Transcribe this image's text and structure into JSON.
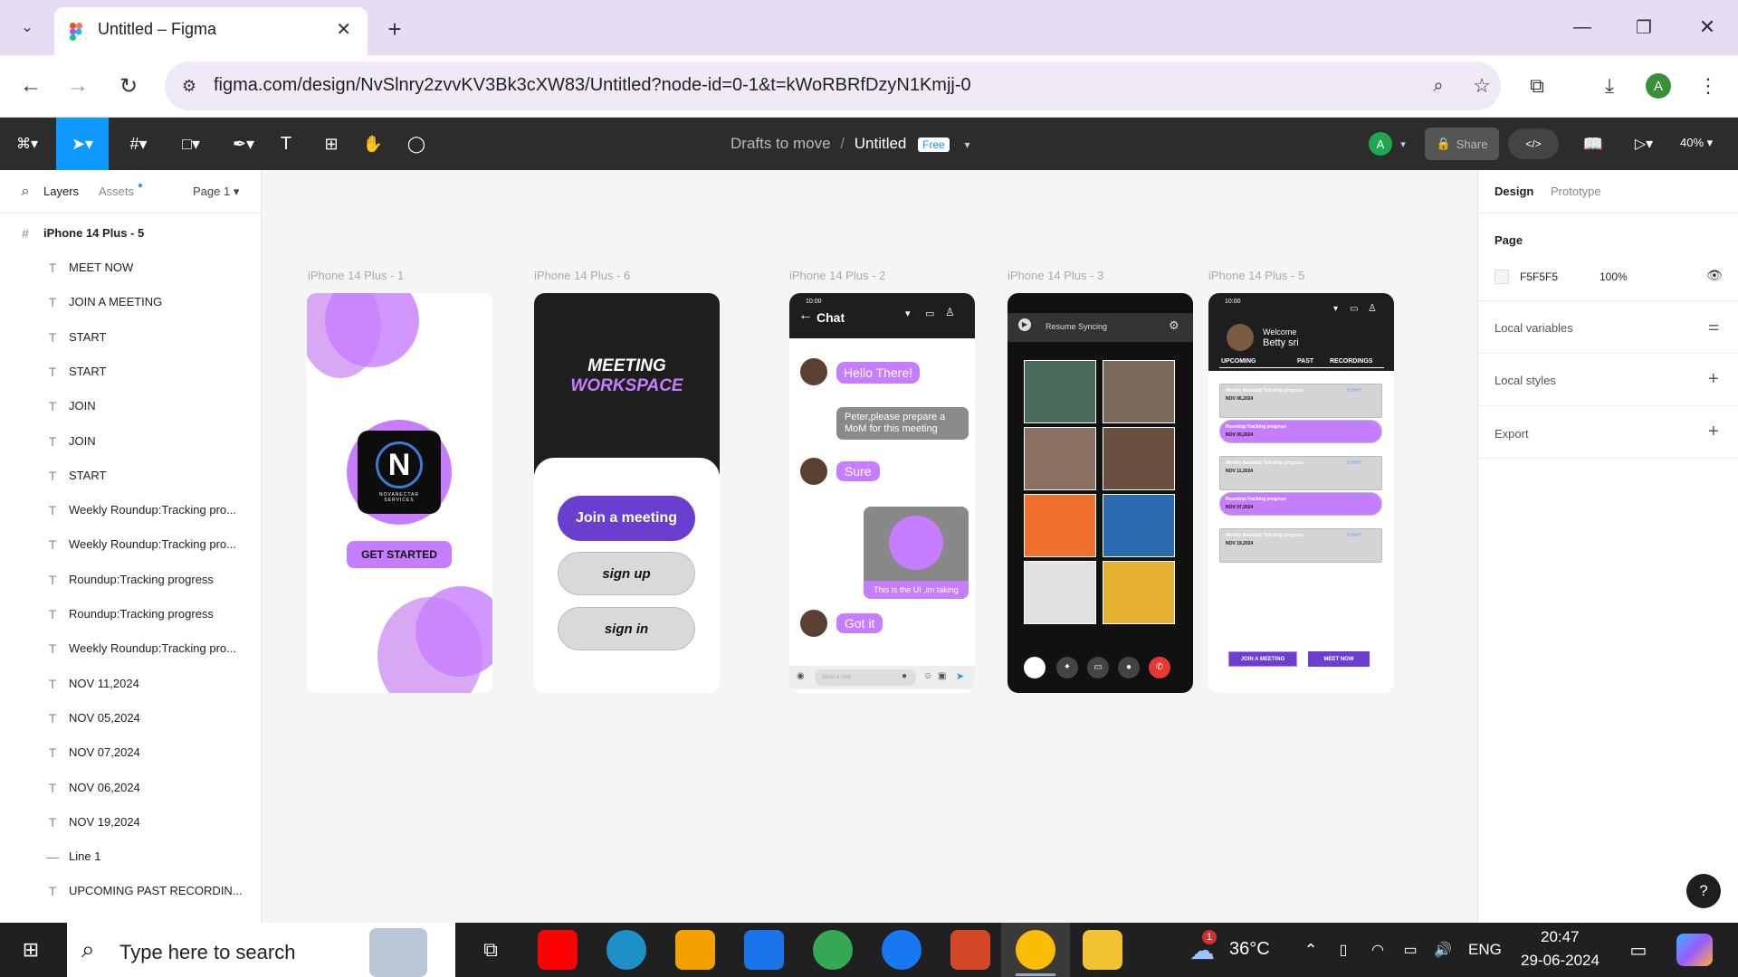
{
  "browser": {
    "tab_title": "Untitled – Figma",
    "url": "figma.com/design/NvSlnry2zvvKV3Bk3cXW83/Untitled?node-id=0-1&t=kWoRBRfDzyN1Kmjj-0",
    "profile_initial": "A"
  },
  "figma": {
    "breadcrumb_folder": "Drafts to move",
    "breadcrumb_sep": "/",
    "file_name": "Untitled",
    "plan_badge": "Free",
    "share_label": "Share",
    "zoom": "40%",
    "avatar_initial": "A"
  },
  "left_panel": {
    "tabs": [
      "Layers",
      "Assets"
    ],
    "page": "Page 1",
    "root_frame": "iPhone 14 Plus - 5",
    "layers": [
      "MEET NOW",
      "JOIN A MEETING",
      "START",
      "START",
      "JOIN",
      "JOIN",
      "START",
      "Weekly Roundup:Tracking pro...",
      "Weekly Roundup:Tracking pro...",
      "Roundup:Tracking progress",
      "Roundup:Tracking progress",
      "Weekly Roundup:Tracking pro...",
      "NOV 11,2024",
      "NOV 05,2024",
      "NOV 07,2024",
      "NOV 06,2024",
      "NOV 19,2024",
      "Line 1",
      "UPCOMING PAST RECORDIN..."
    ]
  },
  "right_panel": {
    "tabs": [
      "Design",
      "Prototype"
    ],
    "section_page": "Page",
    "page_color": "F5F5F5",
    "page_opacity": "100%",
    "local_variables": "Local variables",
    "local_styles": "Local styles",
    "export": "Export"
  },
  "frames": {
    "f1": {
      "label": "iPhone 14 Plus - 1",
      "logo_text": "NOVANECTAR SERVICES",
      "button": "GET STARTED"
    },
    "f6": {
      "label": "iPhone 14 Plus - 6",
      "title1": "MEETING",
      "title2": "WORKSPACE",
      "btn_join": "Join a meeting",
      "btn_signup": "sign up",
      "btn_signin": "sign in"
    },
    "f2": {
      "label": "iPhone 14 Plus - 2",
      "time": "10:00",
      "header": "Chat",
      "m1": "Hello There!",
      "m2": "Peter,please prepare a MoM for this meeting",
      "m3": "Sure",
      "m4": "This is the UI ,im taking",
      "m5": "Got it",
      "input_placeholder": "Send a chat"
    },
    "f3": {
      "label": "iPhone 14 Plus - 3",
      "resume": "Resume Syncing"
    },
    "f5": {
      "label": "iPhone 14 Plus - 5",
      "time": "10:00",
      "welcome": "Welcome",
      "name": "Betty sri",
      "tabs": [
        "UPCOMING",
        "PAST",
        "RECORDINGS"
      ],
      "cards": [
        {
          "title": "Weekly Roundup:Tracking progress",
          "date": "NOV 06,2024",
          "action": "START"
        },
        {
          "title": "Roundup:Tracking progress",
          "date": "NOV 05,2024",
          "action": "JOIN"
        },
        {
          "title": "Weekly Roundup:Tracking progress",
          "date": "NOV 11,2024",
          "action": "START"
        },
        {
          "title": "Roundup:Tracking progress",
          "date": "NOV 07,2024",
          "action": "JOIN"
        },
        {
          "title": "Weekly Roundup:Tracking progress",
          "date": "NOV 19,2024",
          "action": "START"
        }
      ],
      "btn_join": "JOIN A MEETING",
      "btn_meet": "MEET NOW"
    }
  },
  "taskbar": {
    "search_placeholder": "Type here to search",
    "weather": "36°C",
    "weather_badge": "1",
    "lang": "ENG",
    "time": "20:47",
    "date": "29-06-2024"
  },
  "colors": {
    "accent": "#c77dff",
    "purple_button": "#6a3fd0",
    "figma_blue": "#0d99ff",
    "dark": "#1e1e1e"
  }
}
